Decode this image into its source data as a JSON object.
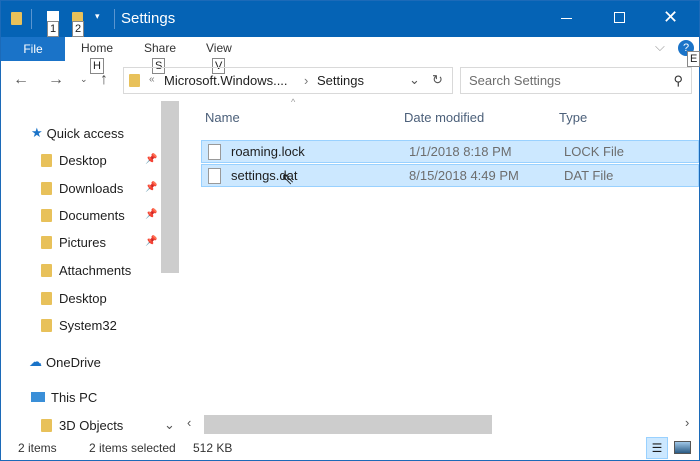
{
  "title": "Settings",
  "qat": {
    "key1": "1",
    "key2": "2"
  },
  "ribbon": {
    "file": "File",
    "tabs": [
      {
        "label": "Home",
        "key": "H"
      },
      {
        "label": "Share",
        "key": "S"
      },
      {
        "label": "View",
        "key": "V"
      }
    ],
    "help_key": "E"
  },
  "address": {
    "overflow": "«",
    "segments": [
      "Microsoft.Windows....",
      "Settings"
    ]
  },
  "search": {
    "placeholder": "Search Settings"
  },
  "nav": [
    {
      "label": "Quick access",
      "icon": "star-icon"
    },
    {
      "label": "Desktop",
      "pinned": true
    },
    {
      "label": "Downloads",
      "pinned": true
    },
    {
      "label": "Documents",
      "pinned": true
    },
    {
      "label": "Pictures",
      "pinned": true
    },
    {
      "label": "Attachments"
    },
    {
      "label": "Desktop"
    },
    {
      "label": "System32"
    },
    {
      "label": "OneDrive",
      "icon": "cloud-icon"
    },
    {
      "label": "This PC",
      "icon": "computer-icon"
    },
    {
      "label": "3D Objects"
    }
  ],
  "columns": {
    "name": "Name",
    "date": "Date modified",
    "type": "Type"
  },
  "files": [
    {
      "name": "roaming.lock",
      "date": "1/1/2018 8:18 PM",
      "type": "LOCK File"
    },
    {
      "name": "settings.dat",
      "date": "8/15/2018 4:49 PM",
      "type": "DAT File"
    }
  ],
  "status": {
    "items": "2 items",
    "selected": "2 items selected",
    "size": "512 KB"
  }
}
